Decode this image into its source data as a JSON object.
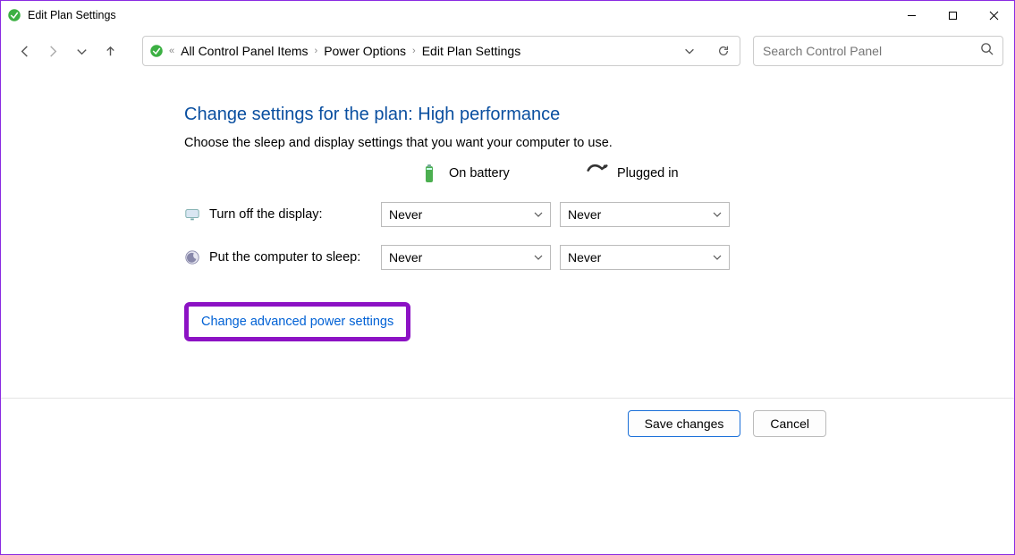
{
  "window": {
    "title": "Edit Plan Settings"
  },
  "breadcrumb": {
    "item0": "All Control Panel Items",
    "item1": "Power Options",
    "item2": "Edit Plan Settings"
  },
  "search": {
    "placeholder": "Search Control Panel"
  },
  "page": {
    "heading": "Change settings for the plan: High performance",
    "subtext": "Choose the sleep and display settings that you want your computer to use.",
    "col_battery": "On battery",
    "col_plugged": "Plugged in",
    "row_display": "Turn off the display:",
    "row_sleep": "Put the computer to sleep:",
    "display_battery_value": "Never",
    "display_plugged_value": "Never",
    "sleep_battery_value": "Never",
    "sleep_plugged_value": "Never",
    "advanced_link": "Change advanced power settings"
  },
  "footer": {
    "save": "Save changes",
    "cancel": "Cancel"
  }
}
